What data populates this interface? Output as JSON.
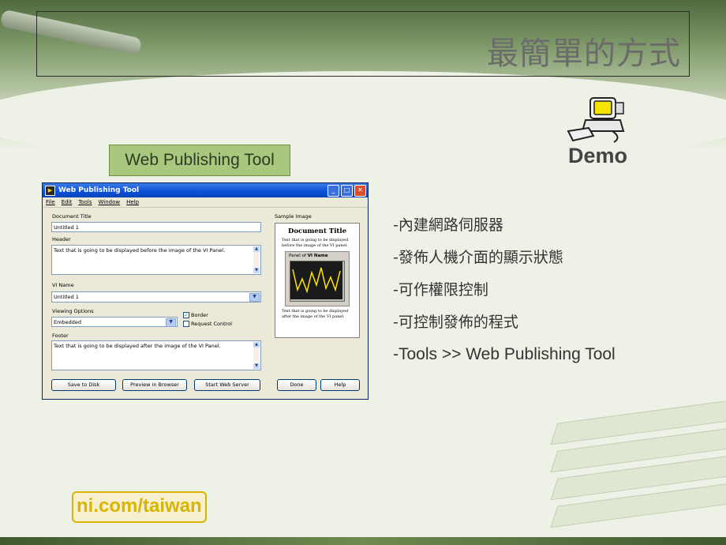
{
  "slide": {
    "title": "最簡單的方式",
    "tool_label": "Web Publishing Tool",
    "demo_label": "Demo",
    "bullets": [
      "-內建網路伺服器",
      "-發佈人機介面的顯示狀態",
      "-可作權限控制",
      "-可控制發佈的程式",
      "-Tools >> Web Publishing Tool"
    ],
    "link": "ni.com/taiwan"
  },
  "window": {
    "title": "Web Publishing Tool",
    "menu": [
      "File",
      "Edit",
      "Tools",
      "Window",
      "Help"
    ],
    "document_title_label": "Document Title",
    "document_title_value": "Untitled 1",
    "header_label": "Header",
    "header_value": "Text that is going to be displayed before the image of the VI Panel.",
    "vi_name_label": "VI Name",
    "vi_name_value": "Untitled 1",
    "viewing_options_label": "Viewing Options",
    "viewing_options_value": "Embedded",
    "border_label": "Border",
    "border_checked": true,
    "request_control_label": "Request Control",
    "request_control_checked": false,
    "footer_label": "Footer",
    "footer_value": "Text that is going to be displayed after the image of the VI Panel.",
    "sample_image_label": "Sample Image",
    "sample": {
      "title": "Document Title",
      "before_text": "Text that is going to be displayed before the image of the VI panel.",
      "panel_prefix": "Panel of",
      "panel_name": "VI Name",
      "after_text": "Text that is going to be displayed after the image of the VI panel."
    },
    "buttons": {
      "save": "Save to Disk",
      "preview": "Preview in Browser",
      "start": "Start Web Server",
      "done": "Done",
      "help": "Help"
    }
  },
  "colors": {
    "accent_green": "#a9c77d",
    "link_gold": "#d9b400",
    "titlebar_blue": "#0a50d8"
  }
}
